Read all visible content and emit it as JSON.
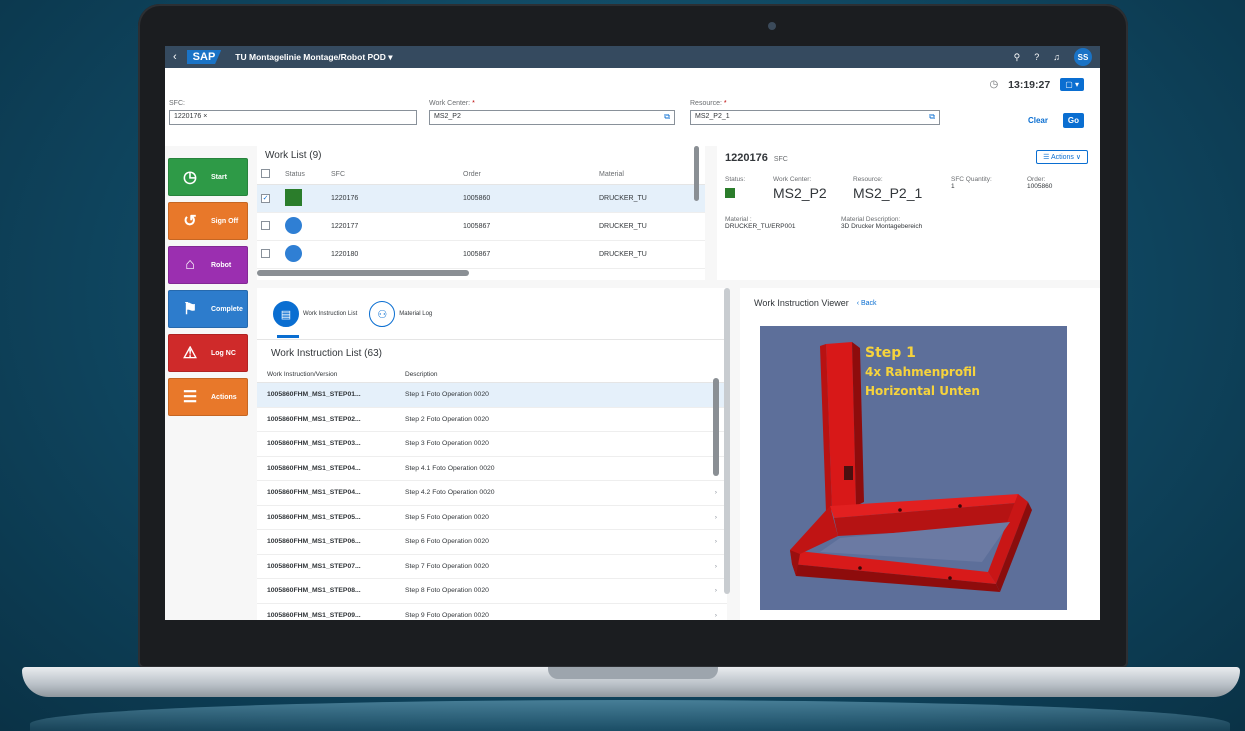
{
  "shell": {
    "app_title": "TU Montagelinie Montage/Robot POD",
    "logo": "SAP",
    "avatar": "SS",
    "icons": [
      "search-icon",
      "help-icon",
      "bell-icon"
    ]
  },
  "header": {
    "time": "13:19:27",
    "time_button": "▢ ▾",
    "sfc_label": "SFC:",
    "sfc_value": "1220176 ×",
    "workcenter_label": "Work Center:",
    "workcenter_value": "MS2_P2",
    "resource_label": "Resource:",
    "resource_value": "MS2_P2_1",
    "required_mark": "*",
    "clear_label": "Clear",
    "go_label": "Go"
  },
  "action_buttons": [
    {
      "label": "Start",
      "color": "#2e9a47",
      "icon": "timer-icon",
      "glyph": "◷"
    },
    {
      "label": "Sign Off",
      "color": "#e8782a",
      "icon": "clock-back-icon",
      "glyph": "↺"
    },
    {
      "label": "Robot",
      "color": "#9b2fb0",
      "icon": "robot-icon",
      "glyph": "⌂"
    },
    {
      "label": "Complete",
      "color": "#2d7ccc",
      "icon": "flag-icon",
      "glyph": "⚑"
    },
    {
      "label": "Log NC",
      "color": "#cf2a2a",
      "icon": "warning-icon",
      "glyph": "⚠"
    },
    {
      "label": "Actions",
      "color": "#e8782a",
      "icon": "list-icon",
      "glyph": "☰"
    }
  ],
  "worklist": {
    "title": "Work List (9)",
    "columns": [
      "Status",
      "SFC",
      "Order",
      "Material"
    ],
    "rows": [
      {
        "checked": "✓",
        "status": "square",
        "sfc": "1220176",
        "order": "1005860",
        "material": "DRUCKER_TU"
      },
      {
        "checked": "",
        "status": "circle",
        "sfc": "1220177",
        "order": "1005867",
        "material": "DRUCKER_TU"
      },
      {
        "checked": "",
        "status": "circle",
        "sfc": "1220180",
        "order": "1005867",
        "material": "DRUCKER_TU"
      }
    ]
  },
  "detail": {
    "sfc": "1220176",
    "sfc_label": "SFC",
    "actions_label": "☰ Actions ∨",
    "status_label": "Status:",
    "workcenter_label": "Work Center:",
    "workcenter_value": "MS2_P2",
    "resource_label": "Resource:",
    "resource_value": "MS2_P2_1",
    "qty_label": "SFC Quantity:",
    "qty_value": "1",
    "order_label": "Order:",
    "order_value": "1005860",
    "material_label": "Material :",
    "material_value": "DRUCKER_TU/ERP001",
    "matdesc_label": "Material Description:",
    "matdesc_value": "3D Drucker Montagebereich"
  },
  "wi_tabs": [
    {
      "label": "Work Instruction List",
      "icon": "document-icon",
      "glyph": "▤"
    },
    {
      "label": "Material Log",
      "icon": "people-icon",
      "glyph": "⚇"
    }
  ],
  "wi_list": {
    "title": "Work Instruction List (63)",
    "col_id": "Work Instruction/Version",
    "col_desc": "Description",
    "rows": [
      {
        "id": "1005860FHM_MS1_STEP01...",
        "desc": "Step 1 Foto Operation 0020"
      },
      {
        "id": "1005860FHM_MS1_STEP02...",
        "desc": "Step 2 Foto Operation 0020"
      },
      {
        "id": "1005860FHM_MS1_STEP03...",
        "desc": "Step 3 Foto Operation 0020"
      },
      {
        "id": "1005860FHM_MS1_STEP04...",
        "desc": "Step 4.1 Foto Operation 0020"
      },
      {
        "id": "1005860FHM_MS1_STEP04...",
        "desc": "Step 4.2 Foto Operation 0020"
      },
      {
        "id": "1005860FHM_MS1_STEP05...",
        "desc": "Step 5 Foto Operation 0020"
      },
      {
        "id": "1005860FHM_MS1_STEP06...",
        "desc": "Step 6 Foto Operation 0020"
      },
      {
        "id": "1005860FHM_MS1_STEP07...",
        "desc": "Step 7 Foto Operation 0020"
      },
      {
        "id": "1005860FHM_MS1_STEP08...",
        "desc": "Step 8 Foto Operation 0020"
      },
      {
        "id": "1005860FHM_MS1_STEP09...",
        "desc": "Step 9 Foto Operation 0020"
      }
    ]
  },
  "viewer": {
    "title": "Work Instruction Viewer",
    "back": "‹ Back",
    "step_title": "Step 1",
    "step_line1": "4x Rahmenprofil",
    "step_line2": "Horizontal Unten"
  }
}
